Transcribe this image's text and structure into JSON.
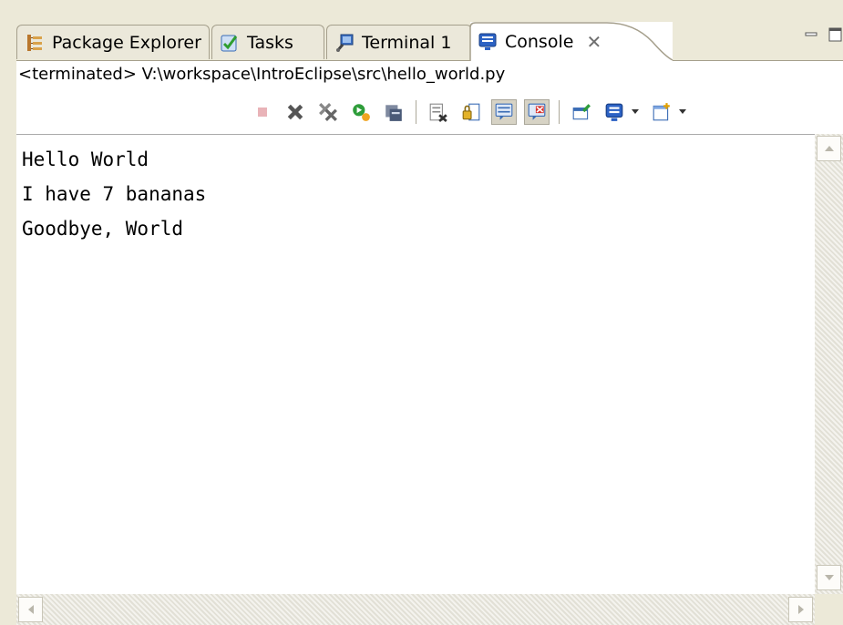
{
  "tabs": [
    {
      "label": "Package Explorer",
      "icon": "package-explorer-icon"
    },
    {
      "label": "Tasks",
      "icon": "tasks-icon"
    },
    {
      "label": "Terminal 1",
      "icon": "terminal-icon"
    }
  ],
  "active_tab": {
    "label": "Console",
    "icon": "console-icon",
    "close_glyph": "✕"
  },
  "window_controls": {
    "minimize": "minimize-icon",
    "maximize": "maximize-icon"
  },
  "process_label": "<terminated> V:\\workspace\\IntroEclipse\\src\\hello_world.py",
  "toolbar": {
    "buttons": [
      "terminate-icon",
      "remove-launch-icon",
      "remove-all-terminated-icon",
      "relaunch-icon",
      "clear-console-icon",
      "scroll-lock-icon",
      "pin-console-icon",
      "show-console-on-stdout-icon",
      "show-console-on-stderr-icon",
      "open-console-icon",
      "display-selected-console-icon",
      "new-console-icon"
    ]
  },
  "console_output": [
    "Hello World",
    "I have 7 bananas",
    "Goodbye, World"
  ]
}
